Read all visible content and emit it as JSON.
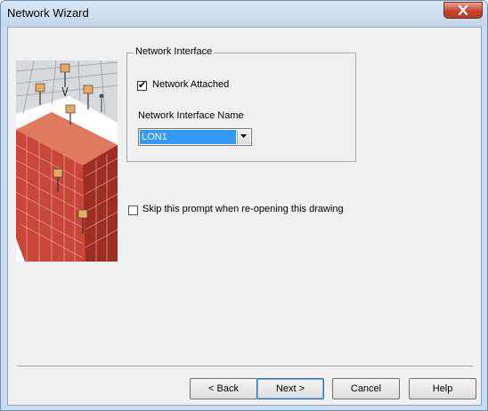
{
  "window": {
    "title": "Network Wizard"
  },
  "group": {
    "legend": "Network Interface"
  },
  "network_attached": {
    "label": "Network Attached",
    "checked": true
  },
  "interface_name": {
    "label": "Network Interface Name",
    "value": "LON1"
  },
  "skip_prompt": {
    "label": "Skip this prompt when re-opening this drawing",
    "checked": false
  },
  "buttons": {
    "back": "< Back",
    "next": "Next >",
    "cancel": "Cancel",
    "help": "Help"
  }
}
